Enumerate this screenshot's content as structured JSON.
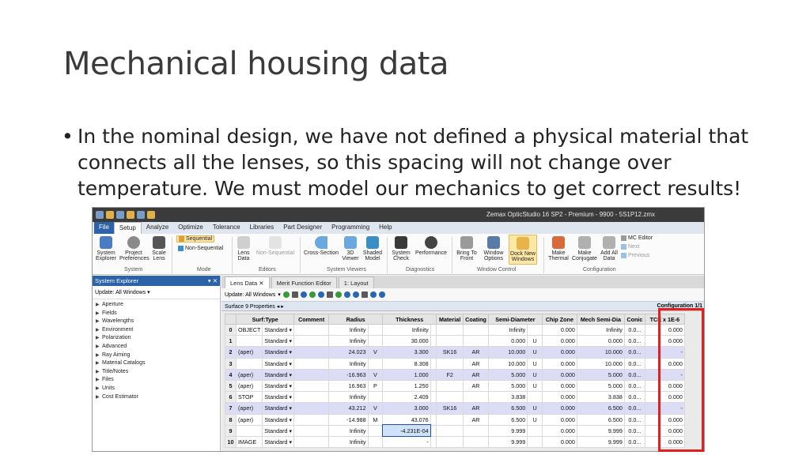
{
  "slide": {
    "title": "Mechanical housing data",
    "bullet_symbol": "•",
    "bullet": "In the nominal design, we have not defined a physical material that connects all the lenses, so this spacing will not change over temperature. We must model our mechanics to get correct results!"
  },
  "app": {
    "window_title": "Zemax OpticStudio 16 SP2 - Premium - 9900 - 5S1P12.zmx",
    "menu": [
      "File",
      "Setup",
      "Analyze",
      "Optimize",
      "Tolerance",
      "Libraries",
      "Part Designer",
      "Programming",
      "Help"
    ],
    "ribbon": {
      "system_explorer": "System Explorer",
      "project_preferences": "Project Preferences",
      "scale_lens": "Scale Lens",
      "sequential": "Sequential",
      "non_sequential": "Non-Sequential",
      "lens_data": "Lens Data",
      "nsc_editor": "Non-Sequential",
      "cross_section": "Cross-Section",
      "viewer_3d": "3D Viewer",
      "shaded_model": "Shaded Model",
      "system_check": "System Check",
      "performance": "Performance",
      "bring_front": "Bring To Front",
      "window_options": "Window Options",
      "dock_new": "Dock New Windows",
      "make_thermal": "Make Thermal",
      "make_conjugate": "Make Conjugate",
      "add_all_data": "Add All Data",
      "mc_editor": "MC Editor",
      "next": "Next",
      "previous": "Previous",
      "groups": [
        "System",
        "Mode",
        "Editors",
        "System Viewers",
        "Diagnostics",
        "Window Control",
        "Configuration"
      ]
    },
    "explorer": {
      "header": "System Explorer",
      "update": "Update: All Windows",
      "items": [
        "Aperture",
        "Fields",
        "Wavelengths",
        "Environment",
        "Polarization",
        "Advanced",
        "Ray Aiming",
        "Material Catalogs",
        "Title/Notes",
        "Files",
        "Units",
        "Cost Estimator"
      ]
    },
    "tabs": [
      "Lens Data",
      "Merit Function Editor",
      "1: Layout"
    ],
    "toolbar_update": "Update: All Windows",
    "surface_props": "Surface 9 Properties",
    "configuration": "Configuration 1/1",
    "columns": [
      "",
      "Surf:Type",
      "",
      "Comment",
      "Radius",
      "",
      "Thickness",
      "",
      "Material",
      "Coating",
      "Semi-Diameter",
      "",
      "Chip Zone",
      "Mech Semi-Dia",
      "Conic",
      "TCE x 1E-6"
    ],
    "rows": [
      {
        "n": "0",
        "name": "OBJECT",
        "type": "Standard",
        "comment": "",
        "radius": "Infinity",
        "rf": "",
        "thick": "Infinity",
        "tf": "",
        "mat": "",
        "coat": "",
        "semi": "Infinity",
        "sf": "",
        "chip": "0.000",
        "mech": "Infinity",
        "conic": "0.0...",
        "tce": "0.000",
        "hi": false
      },
      {
        "n": "1",
        "name": "",
        "type": "Standard",
        "comment": "",
        "radius": "Infinity",
        "rf": "",
        "thick": "30.000",
        "tf": "",
        "mat": "",
        "coat": "",
        "semi": "0.000",
        "sf": "U",
        "chip": "0.000",
        "mech": "0.000",
        "conic": "0.0...",
        "tce": "0.000",
        "hi": false
      },
      {
        "n": "2",
        "name": "(aper)",
        "type": "Standard",
        "comment": "",
        "radius": "24.023",
        "rf": "V",
        "thick": "3.300",
        "tf": "",
        "mat": "SK16",
        "coat": "AR",
        "semi": "10.000",
        "sf": "U",
        "chip": "0.000",
        "mech": "10.000",
        "conic": "0.0...",
        "tce": "-",
        "hi": true
      },
      {
        "n": "3",
        "name": "",
        "type": "Standard",
        "comment": "",
        "radius": "Infinity",
        "rf": "",
        "thick": "8.308",
        "tf": "",
        "mat": "",
        "coat": "AR",
        "semi": "10.000",
        "sf": "U",
        "chip": "0.000",
        "mech": "10.000",
        "conic": "0.0...",
        "tce": "0.000",
        "hi": false
      },
      {
        "n": "4",
        "name": "(aper)",
        "type": "Standard",
        "comment": "",
        "radius": "-16.963",
        "rf": "V",
        "thick": "1.000",
        "tf": "",
        "mat": "F2",
        "coat": "AR",
        "semi": "5.000",
        "sf": "U",
        "chip": "0.000",
        "mech": "5.000",
        "conic": "0.0...",
        "tce": "-",
        "hi": true
      },
      {
        "n": "5",
        "name": "(aper)",
        "type": "Standard",
        "comment": "",
        "radius": "16.963",
        "rf": "P",
        "thick": "1.250",
        "tf": "",
        "mat": "",
        "coat": "AR",
        "semi": "5.000",
        "sf": "U",
        "chip": "0.000",
        "mech": "5.000",
        "conic": "0.0...",
        "tce": "0.000",
        "hi": false
      },
      {
        "n": "6",
        "name": "STOP",
        "type": "Standard",
        "comment": "",
        "radius": "Infinity",
        "rf": "",
        "thick": "2.409",
        "tf": "",
        "mat": "",
        "coat": "",
        "semi": "3.838",
        "sf": "",
        "chip": "0.000",
        "mech": "3.838",
        "conic": "0.0...",
        "tce": "0.000",
        "hi": false
      },
      {
        "n": "7",
        "name": "(aper)",
        "type": "Standard",
        "comment": "",
        "radius": "43.212",
        "rf": "V",
        "thick": "3.000",
        "tf": "",
        "mat": "SK16",
        "coat": "AR",
        "semi": "6.500",
        "sf": "U",
        "chip": "0.000",
        "mech": "6.500",
        "conic": "0.0...",
        "tce": "-",
        "hi": true
      },
      {
        "n": "8",
        "name": "(aper)",
        "type": "Standard",
        "comment": "",
        "radius": "-14.988",
        "rf": "M",
        "thick": "43.076",
        "tf": "",
        "mat": "",
        "coat": "AR",
        "semi": "6.500",
        "sf": "U",
        "chip": "0.000",
        "mech": "6.500",
        "conic": "0.0...",
        "tce": "0.000",
        "hi": false
      },
      {
        "n": "9",
        "name": "",
        "type": "Standard",
        "comment": "",
        "radius": "Infinity",
        "rf": "",
        "thick": "-4.231E-04",
        "tf": "",
        "mat": "",
        "coat": "",
        "semi": "9.999",
        "sf": "",
        "chip": "0.000",
        "mech": "9.999",
        "conic": "0.0...",
        "tce": "0.000",
        "hi": false,
        "edit": true
      },
      {
        "n": "10",
        "name": "IMAGE",
        "type": "Standard",
        "comment": "",
        "radius": "Infinity",
        "rf": "",
        "thick": "-",
        "tf": "",
        "mat": "",
        "coat": "",
        "semi": "9.999",
        "sf": "",
        "chip": "0.000",
        "mech": "9.999",
        "conic": "0.0...",
        "tce": "0.000",
        "hi": false
      }
    ]
  },
  "colors": {
    "highlight_box": "#e02020",
    "accent": "#2b62a8",
    "row_highlight": "#dcdcf6"
  }
}
